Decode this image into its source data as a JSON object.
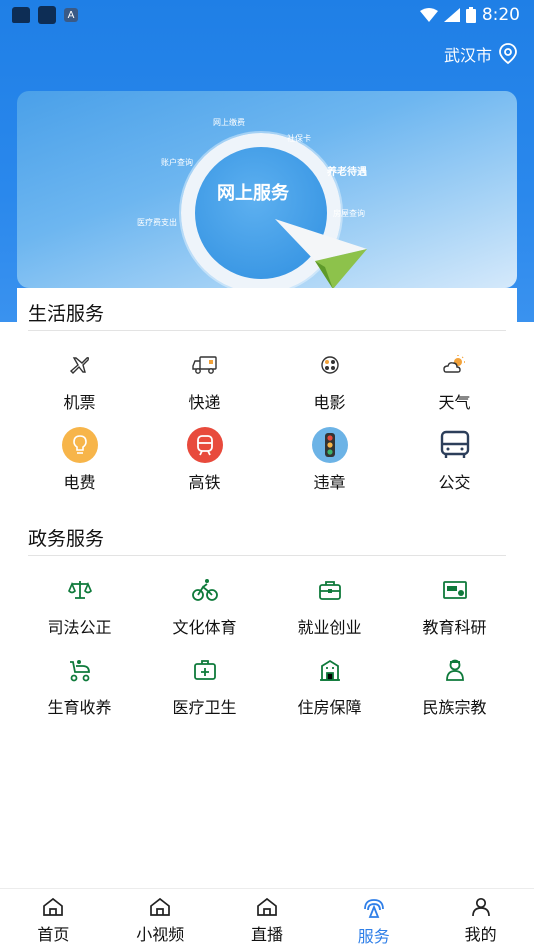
{
  "status_bar": {
    "time": "8:20"
  },
  "header": {
    "location": "武汉市"
  },
  "banner": {
    "center_text": "网上服务",
    "labels": [
      "网上缴费",
      "社保卡",
      "养老待遇",
      "账户查询",
      "医疗费支出",
      "房屋查询"
    ]
  },
  "life_services": {
    "title": "生活服务",
    "items": [
      {
        "label": "机票",
        "icon": "airplane-icon"
      },
      {
        "label": "快递",
        "icon": "delivery-truck-icon"
      },
      {
        "label": "电影",
        "icon": "film-reel-icon"
      },
      {
        "label": "天气",
        "icon": "weather-icon"
      },
      {
        "label": "电费",
        "icon": "lightbulb-icon"
      },
      {
        "label": "高铁",
        "icon": "train-icon"
      },
      {
        "label": "违章",
        "icon": "traffic-light-icon"
      },
      {
        "label": "公交",
        "icon": "bus-icon"
      }
    ]
  },
  "gov_services": {
    "title": "政务服务",
    "items": [
      {
        "label": "司法公正",
        "icon": "scales-icon"
      },
      {
        "label": "文化体育",
        "icon": "cyclist-icon"
      },
      {
        "label": "就业创业",
        "icon": "briefcase-icon"
      },
      {
        "label": "教育科研",
        "icon": "certificate-icon"
      },
      {
        "label": "生育收养",
        "icon": "stroller-icon"
      },
      {
        "label": "医疗卫生",
        "icon": "medical-kit-icon"
      },
      {
        "label": "住房保障",
        "icon": "building-icon"
      },
      {
        "label": "民族宗教",
        "icon": "person-icon"
      }
    ]
  },
  "tabbar": {
    "tabs": [
      {
        "label": "首页",
        "icon": "home-icon"
      },
      {
        "label": "小视频",
        "icon": "home-icon"
      },
      {
        "label": "直播",
        "icon": "home-icon"
      },
      {
        "label": "服务",
        "icon": "service-icon",
        "active": true
      },
      {
        "label": "我的",
        "icon": "user-icon"
      }
    ]
  },
  "colors": {
    "header_blue": "#2a88ec",
    "gov_green": "#0f7a3b",
    "active_tab": "#2f7fe8"
  }
}
